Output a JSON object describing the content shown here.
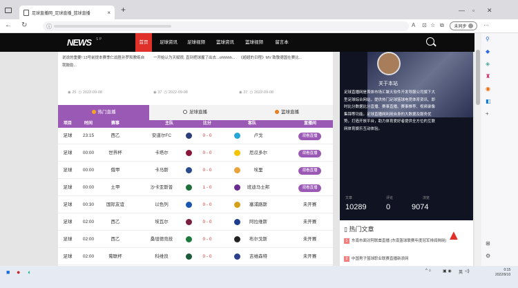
{
  "browser": {
    "tab_title": "足球直播网_足球直播_篮球直播",
    "tab_close": "×",
    "new_tab": "+",
    "profile_label": "未同步"
  },
  "site": {
    "logo": "NEWS",
    "logo_sup": "S P",
    "nav": [
      "首页",
      "足球资讯",
      "足球视频",
      "篮球资讯",
      "篮球视频",
      "留言本"
    ],
    "nav_active": 0
  },
  "articles": [
    {
      "text": "说说的重要! 13号前提本赛季仁战胜孙罗和教练自我鼓励...",
      "views": "25",
      "date": "2022-09-08"
    },
    {
      "text": "一开始认为天赋很, 直到把球握了出去...ohhhhh...",
      "views": "37",
      "date": "2022-09-08"
    },
    {
      "text": "《超超的日程》MV 致敬德国在赛比...",
      "views": "27",
      "date": "2022-09-08"
    }
  ],
  "live_tabs": [
    "热门直播",
    "足球直播",
    "篮球直播"
  ],
  "live_active": 0,
  "table": {
    "headers": [
      "项目",
      "时间",
      "赛事",
      "主队",
      "比分",
      "客队",
      "直播间"
    ],
    "rows": [
      {
        "sport": "足球",
        "time": "23:15",
        "league": "西乙",
        "home": "安道尔FC",
        "score": "0 - 0",
        "away": "卢戈",
        "status": "观看直播",
        "live": true,
        "hc": "#2c3e7a",
        "ac": "#27a7d6"
      },
      {
        "sport": "足球",
        "time": "00:00",
        "league": "世界杯",
        "home": "卡塔尔",
        "score": "0 - 0",
        "away": "厄瓜多尔",
        "status": "观看直播",
        "live": true,
        "hc": "#8a1538",
        "ac": "#f2c500"
      },
      {
        "sport": "足球",
        "time": "00:00",
        "league": "俄甲",
        "home": "卡马斯",
        "score": "0 - 0",
        "away": "埃里",
        "status": "观看直播",
        "live": true,
        "hc": "#2a4b8d",
        "ac": "#e8a33a"
      },
      {
        "sport": "足球",
        "time": "00:00",
        "league": "土甲",
        "home": "沙卡亚斯普",
        "score": "1 - 0",
        "away": "班迪马士邦",
        "status": "观看直播",
        "live": true,
        "hc": "#1f6f3a",
        "ac": "#6b2c91"
      },
      {
        "sport": "足球",
        "time": "00:30",
        "league": "国际友谊",
        "home": "以色列",
        "score": "0 - 0",
        "away": "塞浦路斯",
        "status": "未开赛",
        "live": false,
        "hc": "#1a56b0",
        "ac": "#d4a017"
      },
      {
        "sport": "足球",
        "time": "02:00",
        "league": "西乙",
        "home": "埃瓦尔",
        "score": "0 - 0",
        "away": "阿拉维斯",
        "status": "未开赛",
        "live": false,
        "hc": "#7a1f3d",
        "ac": "#1e3d8f"
      },
      {
        "sport": "足球",
        "time": "02:00",
        "league": "西乙",
        "home": "桑坦德竞技",
        "score": "0 - 0",
        "away": "布尔戈斯",
        "status": "未开赛",
        "live": false,
        "hc": "#1c7a3c",
        "ac": "#222222"
      },
      {
        "sport": "足球",
        "time": "02:00",
        "league": "葡联杯",
        "home": "科维良",
        "score": "0 - 0",
        "away": "吉维森特",
        "status": "未开赛",
        "live": false,
        "hc": "#1c5a3c",
        "ac": "#2b3f8c"
      }
    ]
  },
  "sidebar": {
    "about_title": "关于本站",
    "about_text": "足球直播网是首体市场汇聚天软件开发导服公司旗下大型足球综合网站，提供热门足球篮球电竞体育资讯、即时比分数据比分直播、赛事直播、赛事推荐、视频录像集锦等功能。足球直播网利用自身的大数据及服务优势，打造开放平台，助力体育爱好者提供全方位的互联网体育娱乐互动体验。",
    "stats_labels": [
      "文章",
      "评论",
      "浏览"
    ],
    "stats": [
      "10289",
      "0",
      "9074"
    ],
    "hot_title": "热门文章",
    "hot_items": [
      {
        "num": "1",
        "text": "东南市面对阿联酋直播 (东南篮球联赛年度冠军排闻揭晓)"
      },
      {
        "num": "2",
        "text": "中国男子篮球职业联赛直播新浪网"
      }
    ]
  },
  "taskbar": {
    "time": "0:15",
    "date": "2022/9/10",
    "lang": "英"
  }
}
